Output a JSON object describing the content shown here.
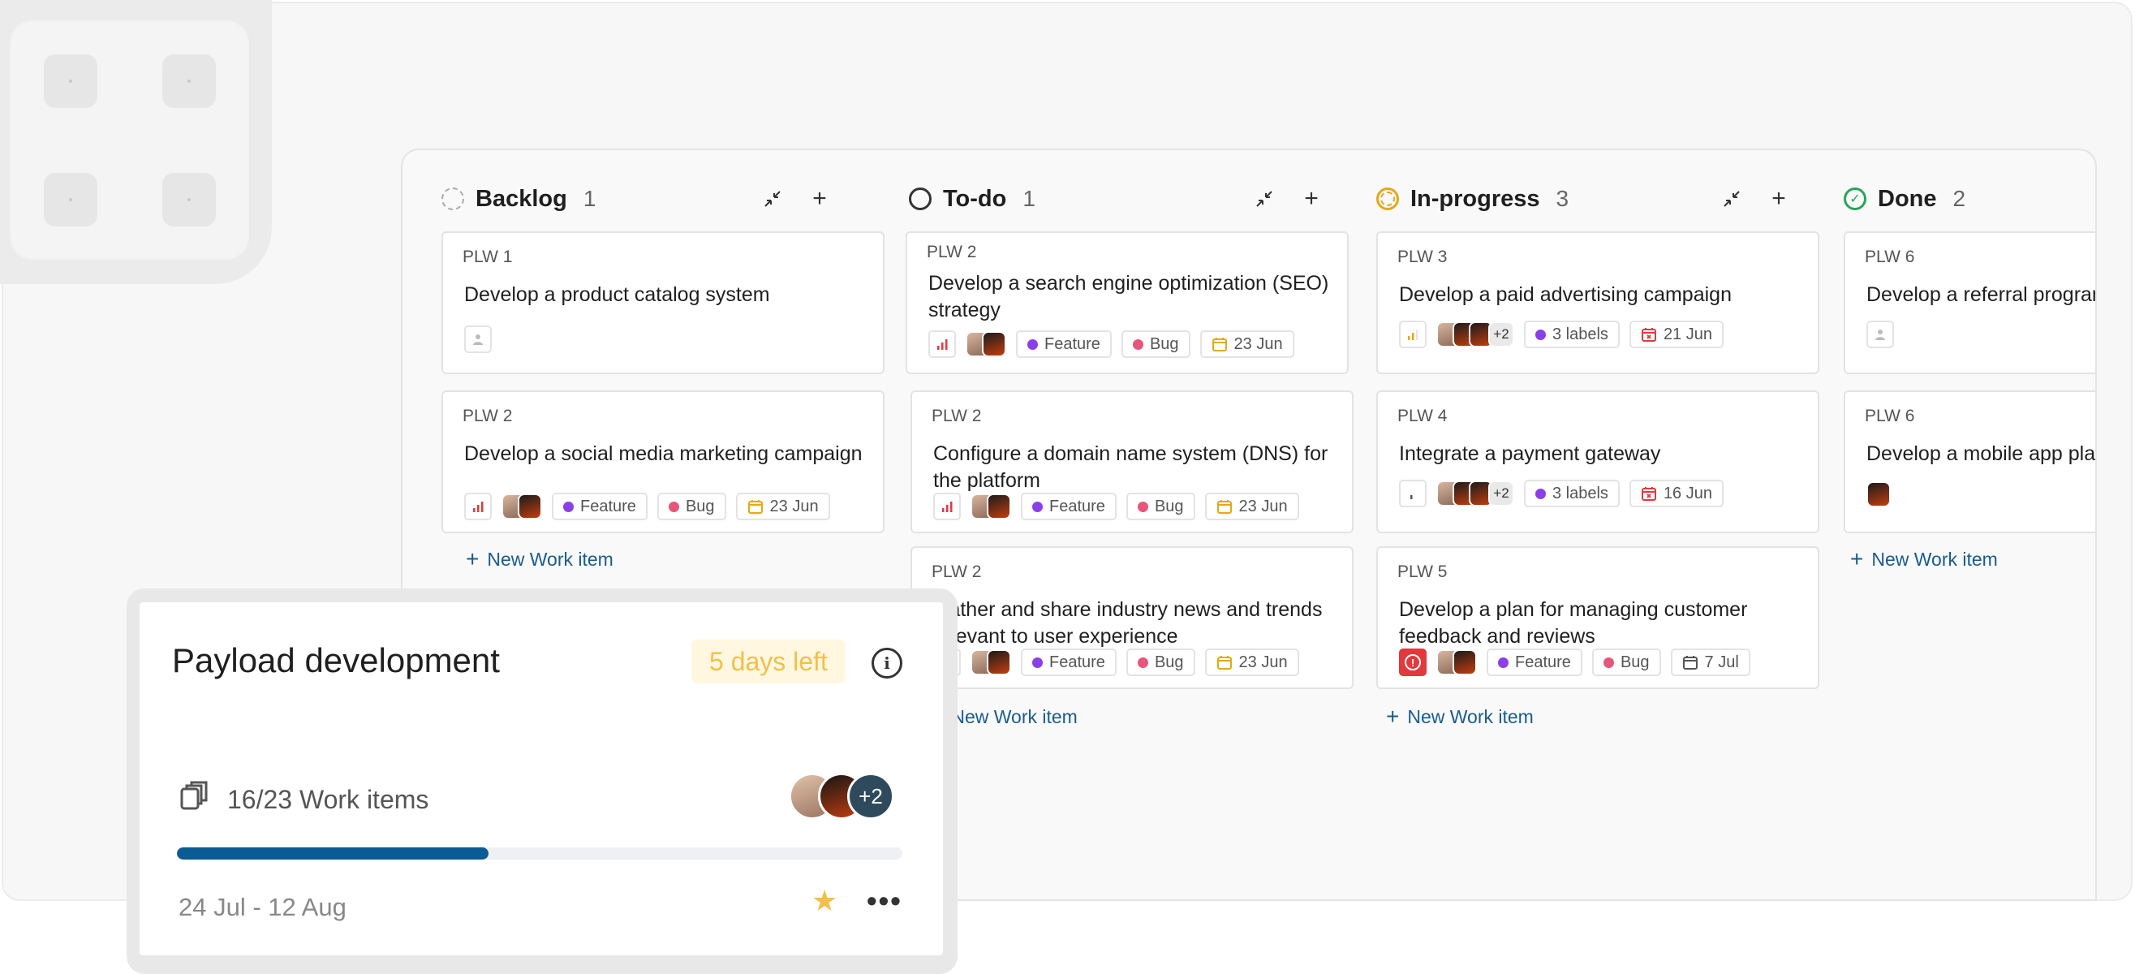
{
  "board": {
    "columns": [
      {
        "key": "backlog",
        "title": "Backlog",
        "count": "1",
        "cards": [
          {
            "id": "PLW 1",
            "title": "Develop a product catalog system"
          },
          {
            "id": "PLW 2",
            "title": "Develop a social media marketing campaign",
            "labels": [
              "Feature",
              "Bug"
            ],
            "due": "23 Jun"
          }
        ],
        "new_item": "New Work item"
      },
      {
        "key": "todo",
        "title": "To-do",
        "count": "1",
        "cards": [
          {
            "id": "PLW 2",
            "title": "Develop a search engine optimization (SEO) strategy",
            "labels": [
              "Feature",
              "Bug"
            ],
            "due": "23 Jun"
          },
          {
            "id": "PLW 2",
            "title": "Configure a domain name system (DNS) for the platform",
            "labels": [
              "Feature",
              "Bug"
            ],
            "due": "23 Jun"
          },
          {
            "id": "PLW 2",
            "title": "Gather and share industry news and trends relevant to user experience",
            "labels": [
              "Feature",
              "Bug"
            ],
            "due": "23 Jun"
          }
        ],
        "new_item": "New Work item"
      },
      {
        "key": "in-progress",
        "title": "In-progress",
        "count": "3",
        "cards": [
          {
            "id": "PLW 3",
            "title": "Develop a paid advertising campaign",
            "extra_assignees": "+2",
            "labels_summary": "3 labels",
            "due": "21 Jun"
          },
          {
            "id": "PLW 4",
            "title": "Integrate a payment gateway",
            "extra_assignees": "+2",
            "labels_summary": "3 labels",
            "due": "16 Jun"
          },
          {
            "id": "PLW 5",
            "title": "Develop a plan for managing customer feedback and reviews",
            "labels": [
              "Feature",
              "Bug"
            ],
            "due": "7 Jul"
          }
        ],
        "new_item": "New Work item"
      },
      {
        "key": "done",
        "title": "Done",
        "count": "2",
        "cards": [
          {
            "id": "PLW 6",
            "title": "Develop a referral program"
          },
          {
            "id": "PLW 6",
            "title": "Develop a mobile app platform"
          }
        ],
        "new_item": "New Work item"
      }
    ]
  },
  "cycle": {
    "title": "Payload development",
    "days_left": "5 days left",
    "work_items": "16/23 Work items",
    "progress_fraction": 0.43,
    "extra_members": "+2",
    "dates": "24 Jul - 12 Aug"
  },
  "colors": {
    "accent": "#0b5b94",
    "link": "#1b5b8c",
    "feature": "#8b3fe8",
    "bug": "#e8557a",
    "due_warning": "#e5a818",
    "due_overdue": "#e0393e",
    "urgent": "#e0393e",
    "done": "#27a55a",
    "star": "#f1c04a"
  }
}
